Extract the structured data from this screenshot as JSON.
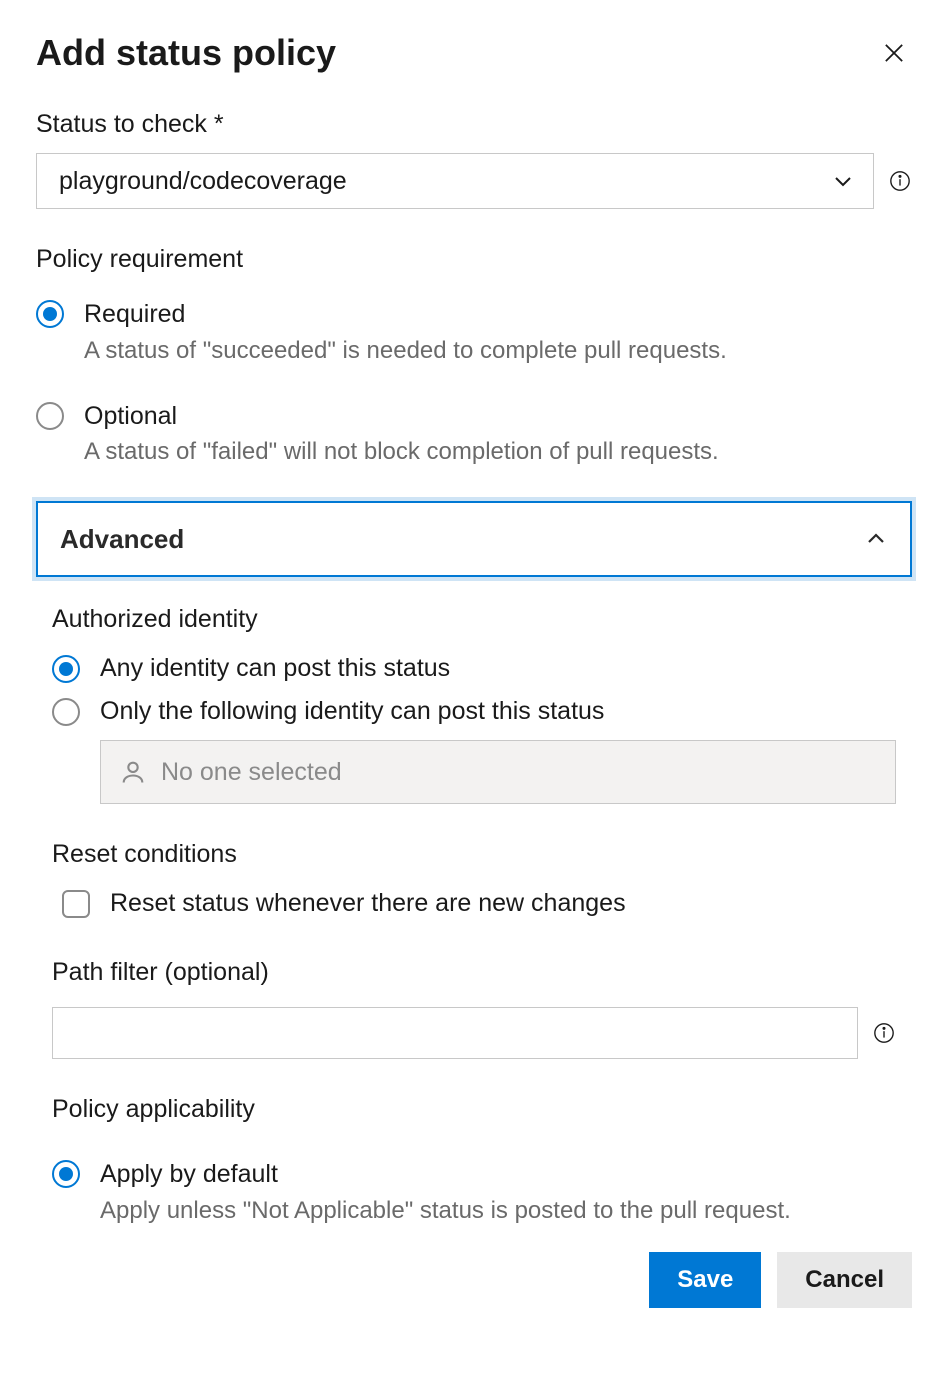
{
  "header": {
    "title": "Add status policy"
  },
  "status_to_check": {
    "label": "Status to check *",
    "value": "playground/codecoverage"
  },
  "policy_requirement": {
    "label": "Policy requirement",
    "options": [
      {
        "label": "Required",
        "help": "A status of \"succeeded\" is needed to complete pull requests.",
        "checked": true
      },
      {
        "label": "Optional",
        "help": "A status of \"failed\" will not block completion of pull requests.",
        "checked": false
      }
    ]
  },
  "advanced": {
    "label": "Advanced",
    "expanded": true,
    "authorized_identity": {
      "label": "Authorized identity",
      "options": [
        {
          "label": "Any identity can post this status",
          "checked": true
        },
        {
          "label": "Only the following identity can post this status",
          "checked": false
        }
      ],
      "identity_placeholder": "No one selected"
    },
    "reset_conditions": {
      "label": "Reset conditions",
      "checkbox_label": "Reset status whenever there are new changes",
      "checked": false
    },
    "path_filter": {
      "label": "Path filter (optional)",
      "value": ""
    },
    "policy_applicability": {
      "label": "Policy applicability",
      "options": [
        {
          "label": "Apply by default",
          "help": "Apply unless \"Not Applicable\" status is posted to the pull request.",
          "checked": true
        }
      ]
    }
  },
  "footer": {
    "save": "Save",
    "cancel": "Cancel"
  }
}
